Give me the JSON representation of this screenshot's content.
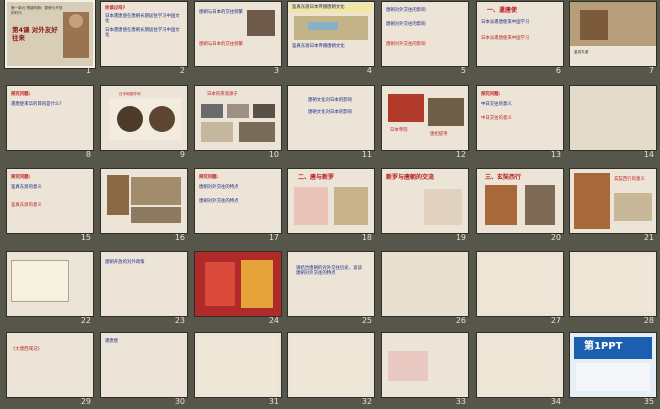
{
  "slide_count": 35,
  "selected_slide": 1,
  "slides": [
    {
      "n": "1",
      "title": "第4课 对外友好往来",
      "line1": "第一单元 隋唐时期：繁荣与开放的时代"
    },
    {
      "n": "2",
      "head": "你读过吗?",
      "body": "日本遣唐使在唐朝长期居住学习中国文化"
    },
    {
      "n": "3",
      "body": "唐朝与日本的交往频繁"
    },
    {
      "n": "4",
      "body": "鉴真东渡日本传播唐朝文化"
    },
    {
      "n": "5",
      "body": "唐朝对外交往的影响"
    },
    {
      "n": "6",
      "title": "一、遣唐使",
      "body": "日本派遣唐使来中国学习"
    },
    {
      "n": "7",
      "body": "鉴真东渡"
    },
    {
      "n": "8",
      "head": "探究问题:",
      "body": "遣唐使来华的目的是什么？"
    },
    {
      "n": "9",
      "title": "日本和铜开珎"
    },
    {
      "n": "10",
      "title": "日本的茶道源于"
    },
    {
      "n": "11",
      "body": "唐朝文化对日本的影响"
    },
    {
      "n": "12",
      "label1": "日本寺院",
      "label2": "唐招提寺"
    },
    {
      "n": "13",
      "head": "探究问题:",
      "body": "中日交往的意义"
    },
    {
      "n": "14",
      "head": "",
      "body": ""
    },
    {
      "n": "15",
      "head": "探究问题:",
      "body": "鉴真东渡的意义"
    },
    {
      "n": "16",
      "body": ""
    },
    {
      "n": "17",
      "head": "探究问题:",
      "body": "唐朝对外交往的特点"
    },
    {
      "n": "18",
      "title": "二、唐与新罗"
    },
    {
      "n": "19",
      "title": "新罗与唐朝的交流"
    },
    {
      "n": "20",
      "title": "三、玄奘西行"
    },
    {
      "n": "21",
      "title": "玄奘西行的意义"
    },
    {
      "n": "22",
      "body": ""
    },
    {
      "n": "23",
      "body": "唐朝开放的对外政策"
    },
    {
      "n": "24",
      "body": ""
    },
    {
      "n": "25",
      "body": "请结合唐朝的对外交往历史，谈谈唐朝对外交往的特点"
    },
    {
      "n": "26",
      "body": ""
    },
    {
      "n": "27",
      "body": ""
    },
    {
      "n": "28",
      "body": ""
    },
    {
      "n": "29",
      "body": "《大唐西域记》"
    },
    {
      "n": "30",
      "body": "遣唐使"
    },
    {
      "n": "31",
      "body": ""
    },
    {
      "n": "32",
      "body": ""
    },
    {
      "n": "33",
      "body": ""
    },
    {
      "n": "34",
      "body": ""
    },
    {
      "n": "35",
      "brand": "第1PPT"
    }
  ]
}
